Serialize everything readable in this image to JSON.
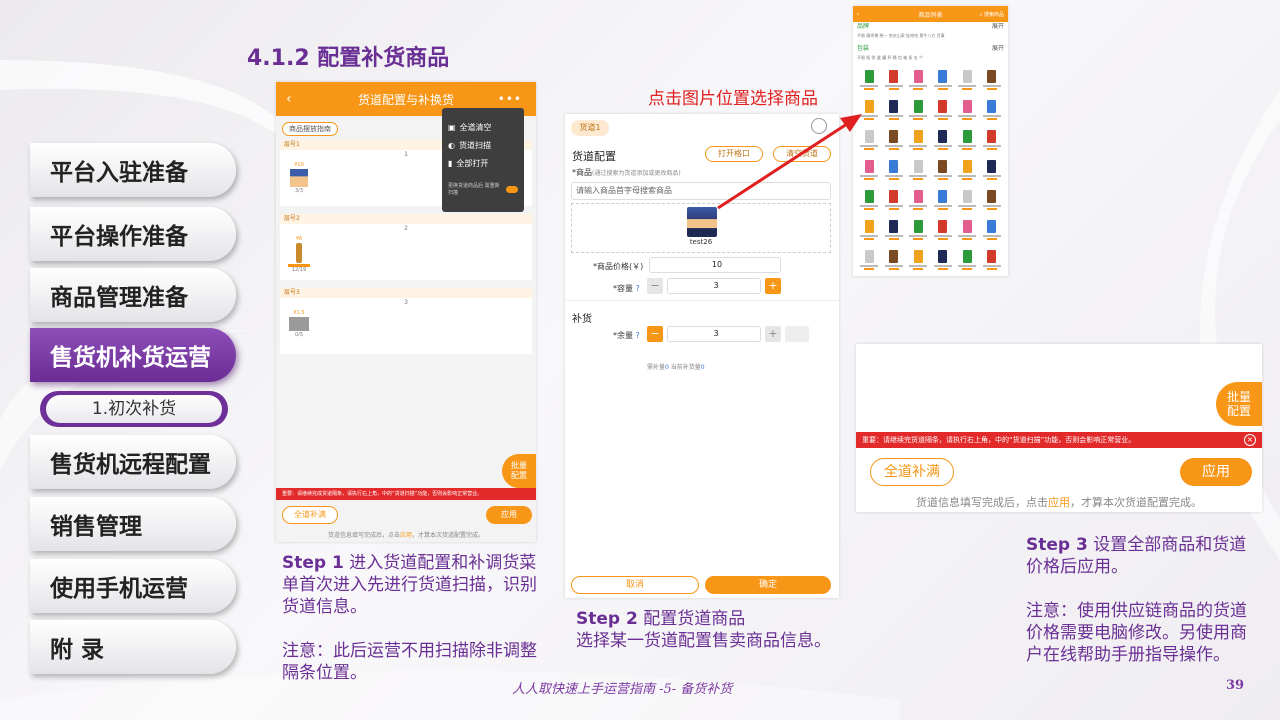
{
  "colors": {
    "accent": "#f79617",
    "brand": "#6a2f94",
    "alert": "#e32a2a"
  },
  "nav": {
    "items": [
      {
        "label": "平台入驻准备"
      },
      {
        "label": "平台操作准备"
      },
      {
        "label": "商品管理准备"
      },
      {
        "label": "售货机补货运营",
        "active": true
      },
      {
        "label": "售货机远程配置"
      },
      {
        "label": "销售管理"
      },
      {
        "label": "使用手机运营"
      },
      {
        "label": "附 录"
      }
    ],
    "sub_item": "1.初次补货"
  },
  "heading": "4.1.2 配置补货商品",
  "annotation": "点击图片位置选择商品",
  "shot1": {
    "title": "货道配置与补换货",
    "tag": "商品摆放指南",
    "menu": [
      "全道清空",
      "货道扫描",
      "全部打开"
    ],
    "menu_hint": "更换货道商品后 需重新扫描",
    "lanes": [
      {
        "name": "层号1",
        "num": "1",
        "price": "¥10",
        "count": "3/3"
      },
      {
        "name": "层号2",
        "num": "2",
        "price": "¥6",
        "count": "12/19"
      },
      {
        "name": "层号3",
        "num": "3",
        "price": "¥1.5",
        "count": "0/5"
      }
    ],
    "batch": "批量\n配置",
    "warning": "重要：请继续完成货道隔条，请执行右上角，中的“货道扫描”功能，否则会影响正常营业。",
    "full": "全道补满",
    "apply": "应用",
    "foot_a": "货道信息填写完成后，点击",
    "foot_b": "应用",
    "foot_c": "，才算本次货道配置完成。"
  },
  "shot2": {
    "tab": "货道1",
    "section": "货道配置",
    "open_btn": "打开格口",
    "clear_btn": "清空货道",
    "product_label": "*商品",
    "product_hint": "(通过搜索为货道添加或更改商品)",
    "search_placeholder": "请输入商品首字母搜索商品",
    "product_name": "test26",
    "price_label": "*商品价格(￥)",
    "price_value": "10",
    "capacity_label": "*容量",
    "capacity_value": "3",
    "restock": "补货",
    "remain_label": "*余量",
    "remain_value": "3",
    "need_a": "需补量",
    "need_b": "0",
    "need_c": " 当前补货量",
    "need_d": "0",
    "cancel": "取消",
    "confirm": "确定"
  },
  "shot3": {
    "title": "商品列表",
    "search": "搜索商品",
    "brand": "品牌",
    "expand": "展开",
    "brands": "不限  康师傅  统一  农夫山泉  娃哈哈  奥牛八方  百事",
    "package": "包装",
    "packages": "不限  瓶  袋  盒  罐  杯  桶  包  箱  条  支  个"
  },
  "shot4": {
    "batch": "批量\n配置",
    "warning": "重要：请继续完货道隔条，请执行右上角，中的“货道扫描”功能，否则会影响正常营业。",
    "full": "全道补满",
    "apply": "应用",
    "foot_a": "货道信息填写完成后，点击",
    "foot_b": "应用",
    "foot_c": "，才算本次货道配置完成。"
  },
  "step1": {
    "step": "Step 1",
    "text": " 进入货道配置和补调货菜单首次进入先进行货道扫描，识别货道信息。",
    "note": "注意：此后运营不用扫描除非调整隔条位置。"
  },
  "step2": {
    "step": "Step 2",
    "text": " 配置货道商品",
    "text2": "选择某一货道配置售卖商品信息。"
  },
  "step3": {
    "step": "Step 3",
    "text": " 设置全部商品和货道价格后应用。",
    "note": "注意：使用供应链商品的货道价格需要电脑修改。另使用商户在线帮助手册指导操作。"
  },
  "footer": "人人取快速上手运营指南 -5- 备货补货",
  "page_number": "39"
}
